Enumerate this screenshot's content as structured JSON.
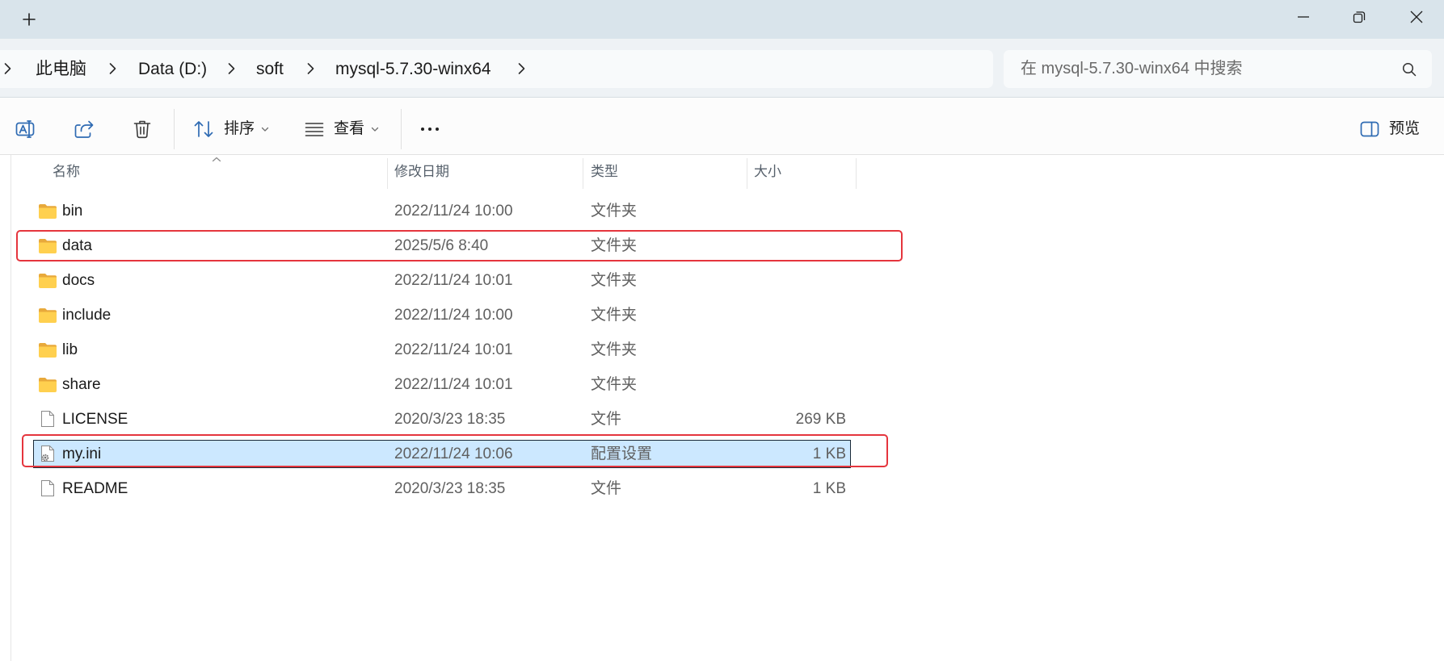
{
  "titlebar": {
    "new_tab_icon": "plus-icon",
    "minimize_icon": "minimize-icon",
    "restore_icon": "restore-icon",
    "close_icon": "close-icon"
  },
  "address_bar": {
    "breadcrumbs": [
      "此电脑",
      "Data (D:)",
      "soft",
      "mysql-5.7.30-winx64"
    ],
    "separator_icon": "chevron-right-icon"
  },
  "search": {
    "placeholder": "在 mysql-5.7.30-winx64 中搜索",
    "icon": "search-icon"
  },
  "toolbar": {
    "rename_icon": "rename-icon",
    "share_icon": "share-icon",
    "delete_icon": "delete-icon",
    "sort_icon": "sort-icon",
    "sort_label": "排序",
    "view_icon": "view-icon",
    "view_label": "查看",
    "more_icon": "more-icon",
    "preview_icon": "preview-pane-icon",
    "preview_label": "预览"
  },
  "columns": {
    "name": "名称",
    "modified": "修改日期",
    "type": "类型",
    "size": "大小",
    "sort_indicator_icon": "chevron-up-icon"
  },
  "files": [
    {
      "name": "bin",
      "modified": "2022/11/24 10:00",
      "type": "文件夹",
      "size": "",
      "icon": "folder-icon",
      "selected": false,
      "annotated": false
    },
    {
      "name": "data",
      "modified": "2025/5/6 8:40",
      "type": "文件夹",
      "size": "",
      "icon": "folder-icon",
      "selected": false,
      "annotated": true
    },
    {
      "name": "docs",
      "modified": "2022/11/24 10:01",
      "type": "文件夹",
      "size": "",
      "icon": "folder-icon",
      "selected": false,
      "annotated": false
    },
    {
      "name": "include",
      "modified": "2022/11/24 10:00",
      "type": "文件夹",
      "size": "",
      "icon": "folder-icon",
      "selected": false,
      "annotated": false
    },
    {
      "name": "lib",
      "modified": "2022/11/24 10:01",
      "type": "文件夹",
      "size": "",
      "icon": "folder-icon",
      "selected": false,
      "annotated": false
    },
    {
      "name": "share",
      "modified": "2022/11/24 10:01",
      "type": "文件夹",
      "size": "",
      "icon": "folder-icon",
      "selected": false,
      "annotated": false
    },
    {
      "name": "LICENSE",
      "modified": "2020/3/23 18:35",
      "type": "文件",
      "size": "269 KB",
      "icon": "file-icon",
      "selected": false,
      "annotated": false
    },
    {
      "name": "my.ini",
      "modified": "2022/11/24 10:06",
      "type": "配置设置",
      "size": "1 KB",
      "icon": "config-file-icon",
      "selected": true,
      "annotated": true
    },
    {
      "name": "README",
      "modified": "2020/3/23 18:35",
      "type": "文件",
      "size": "1 KB",
      "icon": "file-icon",
      "selected": false,
      "annotated": false
    }
  ],
  "colors": {
    "selection": "#cce8ff",
    "selection_border": "#1b2a38",
    "annotation": "#e5353d",
    "folder_back": "#e8a93b",
    "folder_front": "#ffd04f",
    "accent": "#2f6bb3",
    "titlebar": "#d9e4eb"
  }
}
